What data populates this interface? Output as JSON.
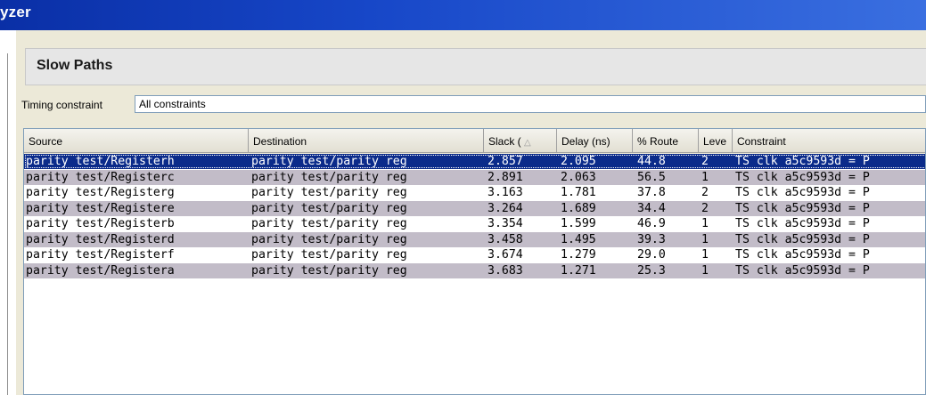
{
  "window": {
    "title_fragment": "yzer"
  },
  "panel": {
    "title": "Slow Paths",
    "constraint_label": "Timing constraint",
    "constraint_value": "All constraints"
  },
  "table": {
    "columns": [
      "Source",
      "Destination",
      "Slack (",
      "Delay (ns)",
      "% Route",
      "Leve",
      "Constraint"
    ],
    "sort_indicator": "△",
    "rows": [
      [
        "parity test/Registerh",
        "parity test/parity reg",
        "2.857",
        "2.095",
        "44.8",
        "2",
        "TS clk a5c9593d = P"
      ],
      [
        "parity test/Registerc",
        "parity test/parity reg",
        "2.891",
        "2.063",
        "56.5",
        "1",
        "TS clk a5c9593d = P"
      ],
      [
        "parity test/Registerg",
        "parity test/parity reg",
        "3.163",
        "1.781",
        "37.8",
        "2",
        "TS clk a5c9593d = P"
      ],
      [
        "parity test/Registere",
        "parity test/parity reg",
        "3.264",
        "1.689",
        "34.4",
        "2",
        "TS clk a5c9593d = P"
      ],
      [
        "parity test/Registerb",
        "parity test/parity reg",
        "3.354",
        "1.599",
        "46.9",
        "1",
        "TS clk a5c9593d = P"
      ],
      [
        "parity test/Registerd",
        "parity test/parity reg",
        "3.458",
        "1.495",
        "39.3",
        "1",
        "TS clk a5c9593d = P"
      ],
      [
        "parity test/Registerf",
        "parity test/parity reg",
        "3.674",
        "1.279",
        "29.0",
        "1",
        "TS clk a5c9593d = P"
      ],
      [
        "parity test/Registera",
        "parity test/parity reg",
        "3.683",
        "1.271",
        "25.3",
        "1",
        "TS clk a5c9593d = P"
      ]
    ],
    "selected_row": 0
  },
  "colors": {
    "titlebar": "#0a2fa6",
    "selected_row": "#0b2b8a",
    "odd_row": "#c2bcc8"
  }
}
